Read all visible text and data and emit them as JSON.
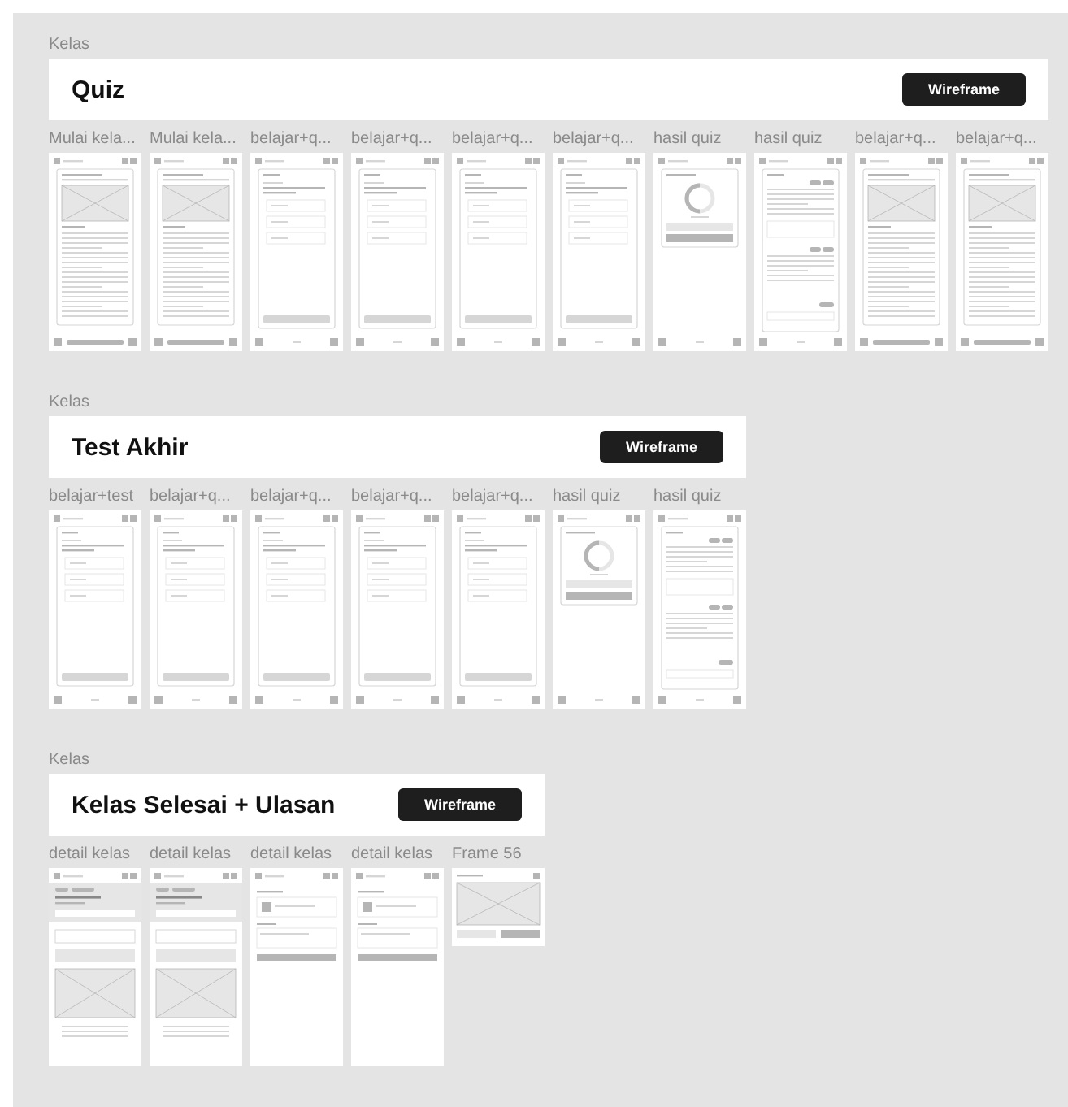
{
  "sections": [
    {
      "label": "Kelas",
      "title": "Quiz",
      "button": "Wireframe",
      "frames": [
        {
          "name": "Mulai kela...",
          "kind": "lesson"
        },
        {
          "name": "Mulai kela...",
          "kind": "lesson"
        },
        {
          "name": "belajar+q...",
          "kind": "quiz"
        },
        {
          "name": "belajar+q...",
          "kind": "quiz"
        },
        {
          "name": "belajar+q...",
          "kind": "quiz"
        },
        {
          "name": "belajar+q...",
          "kind": "quiz"
        },
        {
          "name": "hasil quiz",
          "kind": "result"
        },
        {
          "name": "hasil quiz",
          "kind": "review"
        },
        {
          "name": "belajar+q...",
          "kind": "lesson"
        },
        {
          "name": "belajar+q...",
          "kind": "lesson"
        }
      ]
    },
    {
      "label": "Kelas",
      "title": "Test Akhir",
      "button": "Wireframe",
      "frames": [
        {
          "name": "belajar+test",
          "kind": "quiz"
        },
        {
          "name": "belajar+q...",
          "kind": "quiz"
        },
        {
          "name": "belajar+q...",
          "kind": "quiz"
        },
        {
          "name": "belajar+q...",
          "kind": "quiz"
        },
        {
          "name": "belajar+q...",
          "kind": "quiz"
        },
        {
          "name": "hasil quiz",
          "kind": "result"
        },
        {
          "name": "hasil quiz",
          "kind": "review"
        }
      ]
    },
    {
      "label": "Kelas",
      "title": "Kelas Selesai + Ulasan",
      "button": "Wireframe",
      "frames": [
        {
          "name": "detail kelas",
          "kind": "detail"
        },
        {
          "name": "detail kelas",
          "kind": "detail"
        },
        {
          "name": "detail kelas",
          "kind": "form"
        },
        {
          "name": "detail kelas",
          "kind": "form"
        },
        {
          "name": "Frame 56",
          "kind": "certificate"
        }
      ]
    }
  ]
}
